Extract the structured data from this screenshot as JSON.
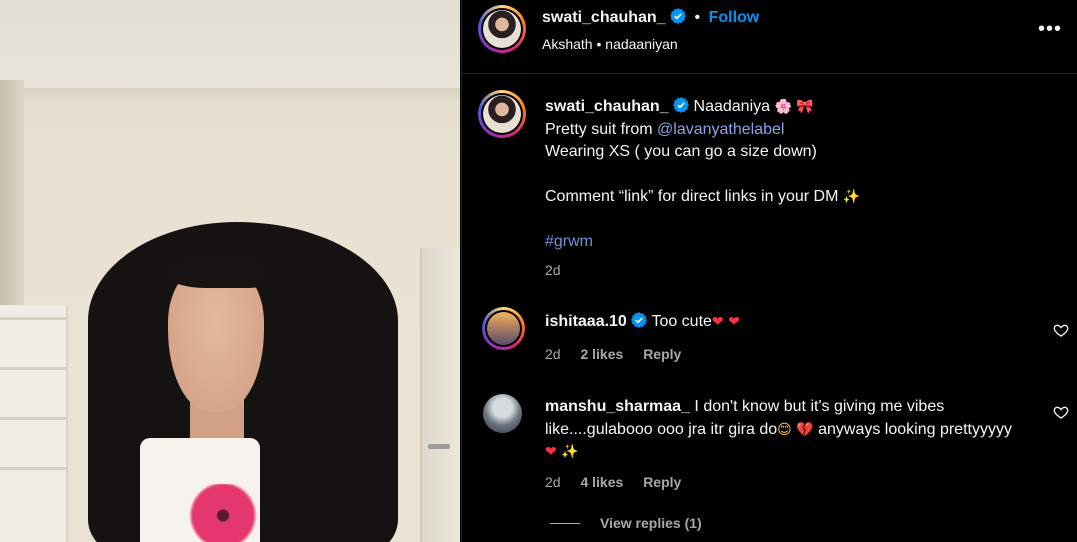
{
  "post": {
    "username": "swati_chauhan_",
    "follow_label": "Follow",
    "audio_artist": "Akshath",
    "audio_title": "nadaaniyan",
    "more_icon": "more-options-icon"
  },
  "caption": {
    "username": "swati_chauhan_",
    "line1_text": "Naadaniya",
    "line1_emojis": [
      "🌸",
      "🎀"
    ],
    "line2_prefix": "Pretty suit from ",
    "line2_mention": "@lavanyathelabel",
    "line3": "Wearing XS ( you can go a size down)",
    "line4": "Comment “link” for direct links in your DM",
    "line4_emoji": "✨",
    "hashtag": "#grwm",
    "time": "2d"
  },
  "comments": [
    {
      "username": "ishitaaa.10",
      "verified": true,
      "text": "Too cute",
      "emojis": [
        "❤",
        "❤"
      ],
      "time": "2d",
      "likes": "2 likes",
      "reply_label": "Reply"
    },
    {
      "username": "manshu_sharmaa_",
      "verified": false,
      "text_part1": "I don't know but it's giving me vibes",
      "text_part2": "like....gulabooo ooo jra itr gira do",
      "emoji_a": "😊",
      "emoji_b": "💔",
      "text_part3": "anyways looking",
      "text_part4": "prettyyyyy",
      "emoji_c": "❤",
      "emoji_d": "✨",
      "time": "2d",
      "likes": "4 likes",
      "reply_label": "Reply",
      "view_replies": "View replies (1)"
    }
  ],
  "colors": {
    "background": "#000000",
    "text": "#f5f5f5",
    "muted": "#a8a8a8",
    "follow": "#0095f6",
    "verified": "#0095f6",
    "mention": "#8aa4e4"
  }
}
